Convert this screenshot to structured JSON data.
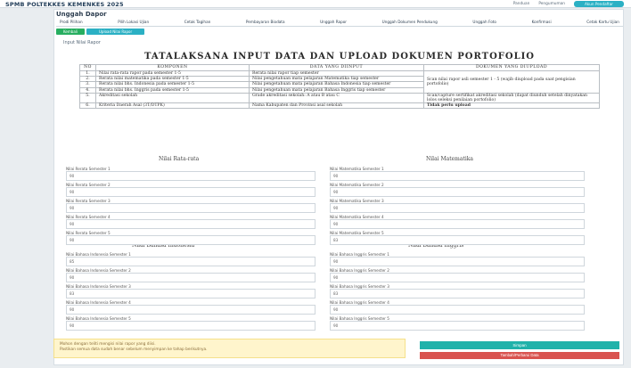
{
  "header": {
    "brand": "SPMB POLTEKKES KEMENKES 2025",
    "nav": [
      "Panduan",
      "Pengumuman"
    ],
    "user_pill": "Akun Pendaftar"
  },
  "page": {
    "title": "Unggah Dapor"
  },
  "tabs": [
    {
      "label": "Prodi Pilihan",
      "active": false
    },
    {
      "label": "Pilih Lokasi Ujian",
      "active": false
    },
    {
      "label": "Cetak Tagihan",
      "active": false
    },
    {
      "label": "Pembayaran Biodata",
      "active": false
    },
    {
      "label": "Unggah Rapor",
      "active": false
    },
    {
      "label": "Unggah Dokumen Pendukung",
      "active": false
    },
    {
      "label": "Unggah Foto",
      "active": false
    },
    {
      "label": "Konfirmasi",
      "active": false
    },
    {
      "label": "Cetak Kartu Ujian",
      "active": false
    }
  ],
  "subtabs": [
    {
      "label": "Kembali"
    },
    {
      "label": "Upload Nilai Rapor"
    }
  ],
  "section_caption": "Input Nilai Rapor",
  "main_title": "TATALAKSANA INPUT DATA DAN UPLOAD DOKUMEN PORTOFOLIO",
  "table": {
    "headers": [
      "NO",
      "KOMPONEN",
      "DATA YANG DIINPUT",
      "DOKUMEN YANG DIUPLOAD"
    ],
    "rows": [
      {
        "no": "1.",
        "komponen": "Nilai rata-rata rapor pada semester 1-5",
        "data": "Rerata nilai rapor tiap semester",
        "dokumen": ""
      },
      {
        "no": "2.",
        "komponen": "Rerata nilai matematika pada semester 1-5",
        "data": "Nilai pengetahuan mata pelajaran Matematika tiap semester",
        "dokumen": "Scan nilai rapor asli semester 1 - 5 (wajib diupload pada saat pengisian portofolio)"
      },
      {
        "no": "3.",
        "komponen": "Rerata nilai bhs. Indonesia pada semester 1-5",
        "data": "Nilai pengetahuan mata pelajaran Bahasa Indonesia tiap semester",
        "dokumen": ""
      },
      {
        "no": "4.",
        "komponen": "Rerata nilai bhs. Inggris pada semester 1-5",
        "data": "Nilai pengetahuan mata pelajaran Bahasa Inggris tiap semester",
        "dokumen": ""
      },
      {
        "no": "5.",
        "komponen": "Akreditasi sekolah",
        "data": "Grade akreditasi sekolah: A atau B atau C",
        "dokumen": "Scan/capture sertifikat akreditasi sekolah (dapat diunduh setelah dinyatakan lolos seleksi penilaian portofolio)"
      },
      {
        "no": "6.",
        "komponen": "Kriteria Daerah Asal (3T/DTPK)",
        "data": "Nama Kabupaten dan Provinsi asal sekolah",
        "dokumen": "Tidak perlu upload"
      }
    ]
  },
  "columns": {
    "rata_rata": {
      "title": "Nilai Rata-rata",
      "fields": [
        {
          "label": "Nilai Rerata Semester 1",
          "value": "90"
        },
        {
          "label": "Nilai Rerata Semester 2",
          "value": "90"
        },
        {
          "label": "Nilai Rerata Semester 3",
          "value": "90"
        },
        {
          "label": "Nilai Rerata Semester 4",
          "value": "90"
        },
        {
          "label": "Nilai Rerata Semester 5",
          "value": "90"
        }
      ]
    },
    "matematika": {
      "title": "Nilai Matematika",
      "fields": [
        {
          "label": "Nilai Matematika Semester 1",
          "value": "90"
        },
        {
          "label": "Nilai Matematika Semester 2",
          "value": "90"
        },
        {
          "label": "Nilai Matematika Semester 3",
          "value": "90"
        },
        {
          "label": "Nilai Matematika Semester 4",
          "value": "90"
        },
        {
          "label": "Nilai Matematika Semester 5",
          "value": "83"
        }
      ]
    },
    "indonesia": {
      "title": "Nilai Bahasa Indonesia",
      "fields": [
        {
          "label": "Nilai Bahasa Indonesia Semester 1",
          "value": "85"
        },
        {
          "label": "Nilai Bahasa Indonesia Semester 2",
          "value": "90"
        },
        {
          "label": "Nilai Bahasa Indonesia Semester 3",
          "value": "83"
        },
        {
          "label": "Nilai Bahasa Indonesia Semester 4",
          "value": "90"
        },
        {
          "label": "Nilai Bahasa Indonesia Semester 5",
          "value": "90"
        }
      ]
    },
    "inggris": {
      "title": "Nilai Bahasa Inggris",
      "fields": [
        {
          "label": "Nilai Bahasa Inggris Semester 1",
          "value": "90"
        },
        {
          "label": "Nilai Bahasa Inggris Semester 2",
          "value": "90"
        },
        {
          "label": "Nilai Bahasa Inggris Semester 3",
          "value": "83"
        },
        {
          "label": "Nilai Bahasa Inggris Semester 4",
          "value": "90"
        },
        {
          "label": "Nilai Bahasa Inggris Semester 5",
          "value": "90"
        }
      ]
    }
  },
  "alert": {
    "line1": "Mohon dengan teliti mengisi nilai rapor yang diisi.",
    "line2": "Pastikan semua data sudah benar sebelum menyimpan ke tahap berikutnya."
  },
  "buttons": {
    "save": "Simpan",
    "cancel": "Tambah/Perbarui Data"
  }
}
